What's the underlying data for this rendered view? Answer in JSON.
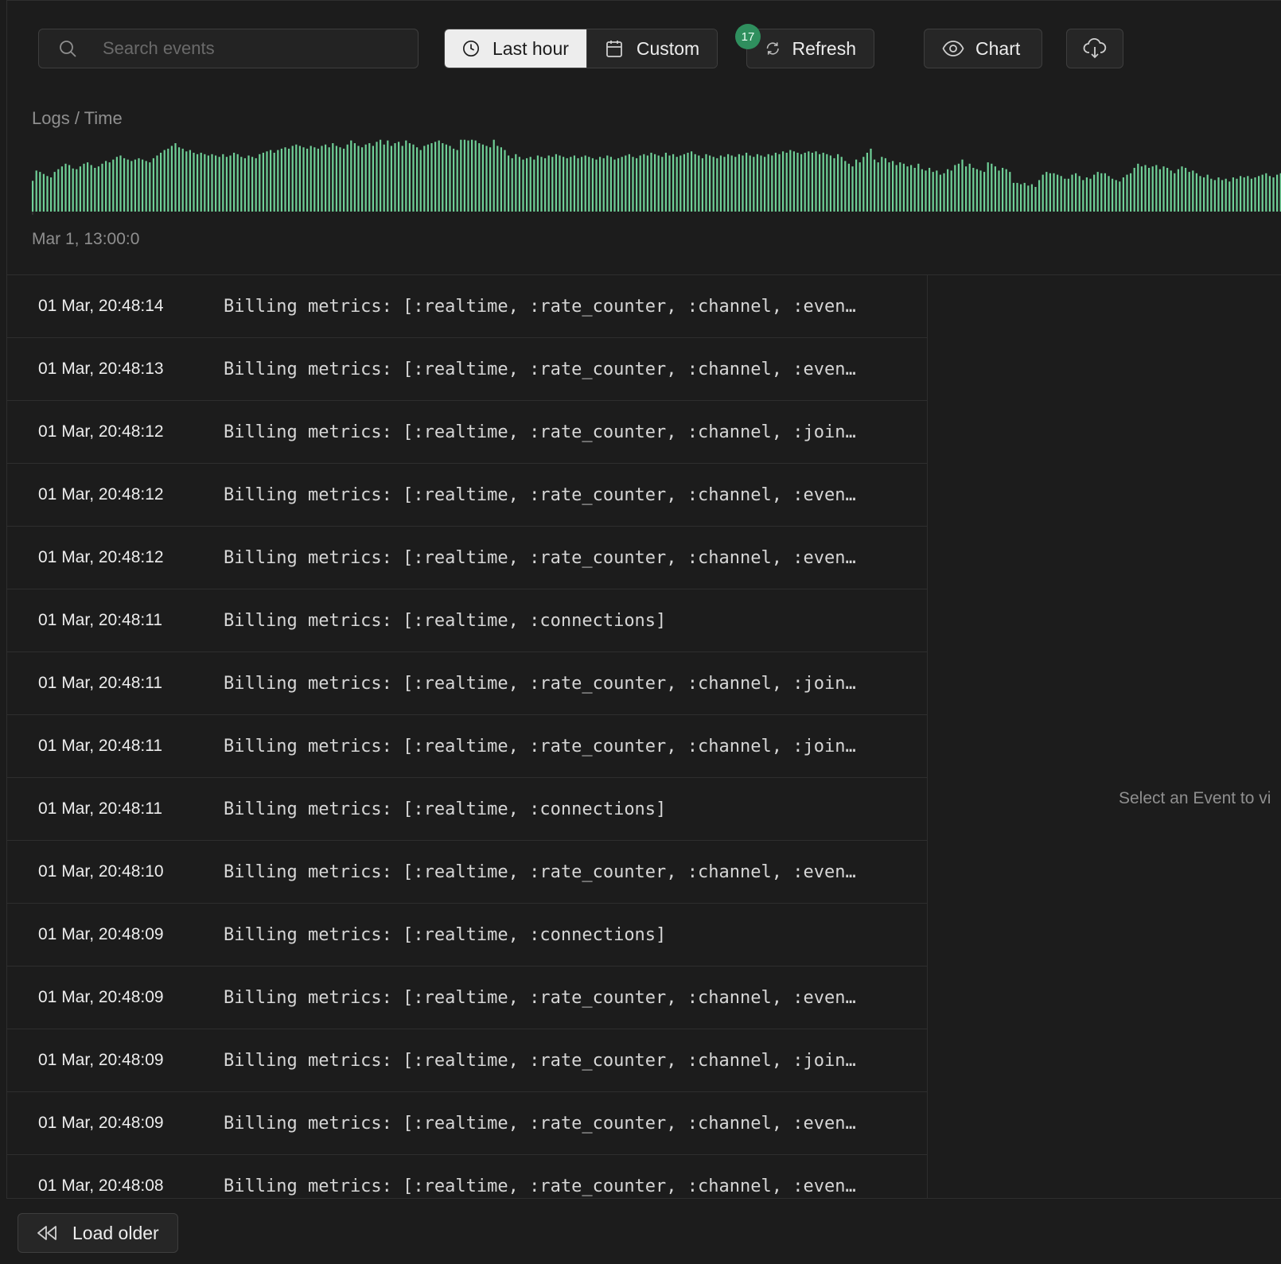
{
  "toolbar": {
    "search_placeholder": "Search events",
    "range_last_hour": "Last hour",
    "range_custom": "Custom",
    "refresh_label": "Refresh",
    "refresh_badge": "17",
    "chart_label": "Chart"
  },
  "chart": {
    "title": "Logs / Time",
    "start_label": "Mar 1, 13:00:0",
    "bar_color": "#6fcf97"
  },
  "chart_data": {
    "type": "bar",
    "title": "Logs / Time",
    "x_start": "Mar 1, 13:00:0",
    "values": [
      45,
      60,
      58,
      55,
      52,
      50,
      58,
      62,
      66,
      70,
      68,
      63,
      62,
      66,
      70,
      72,
      68,
      64,
      66,
      70,
      74,
      72,
      76,
      80,
      82,
      78,
      76,
      74,
      76,
      78,
      76,
      74,
      72,
      78,
      82,
      86,
      90,
      92,
      96,
      100,
      94,
      92,
      88,
      90,
      86,
      84,
      86,
      84,
      82,
      84,
      82,
      80,
      84,
      80,
      82,
      86,
      84,
      80,
      78,
      82,
      80,
      78,
      84,
      86,
      88,
      90,
      86,
      90,
      92,
      94,
      92,
      96,
      98,
      96,
      94,
      92,
      96,
      94,
      92,
      96,
      98,
      94,
      100,
      96,
      94,
      92,
      98,
      104,
      100,
      96,
      94,
      98,
      100,
      96,
      102,
      108,
      98,
      104,
      96,
      100,
      102,
      96,
      104,
      100,
      98,
      94,
      90,
      96,
      98,
      100,
      102,
      104,
      100,
      98,
      96,
      92,
      90,
      112,
      108,
      104,
      112,
      104,
      100,
      98,
      96,
      94,
      108,
      96,
      94,
      90,
      82,
      78,
      84,
      80,
      76,
      78,
      80,
      76,
      82,
      80,
      78,
      82,
      80,
      84,
      82,
      80,
      78,
      80,
      82,
      78,
      80,
      82,
      80,
      78,
      76,
      80,
      78,
      82,
      80,
      76,
      78,
      80,
      82,
      84,
      80,
      78,
      82,
      84,
      82,
      86,
      84,
      82,
      80,
      86,
      82,
      84,
      80,
      82,
      84,
      86,
      88,
      84,
      82,
      78,
      84,
      82,
      80,
      78,
      82,
      80,
      84,
      82,
      80,
      84,
      82,
      86,
      82,
      80,
      84,
      82,
      80,
      84,
      82,
      86,
      84,
      88,
      86,
      90,
      88,
      86,
      84,
      86,
      88,
      86,
      88,
      84,
      86,
      84,
      82,
      78,
      84,
      80,
      74,
      70,
      66,
      76,
      72,
      80,
      86,
      92,
      76,
      72,
      80,
      78,
      72,
      74,
      68,
      72,
      70,
      66,
      68,
      64,
      70,
      62,
      60,
      64,
      58,
      60,
      54,
      56,
      62,
      60,
      68,
      70,
      76,
      66,
      70,
      64,
      62,
      60,
      58,
      72,
      70,
      66,
      60,
      64,
      62,
      58,
      42,
      42,
      40,
      42,
      38,
      40,
      36,
      46,
      54,
      58,
      56,
      56,
      54,
      52,
      48,
      48,
      54,
      56,
      52,
      46,
      50,
      48,
      54,
      58,
      56,
      56,
      52,
      48,
      46,
      44,
      50,
      54,
      56,
      64,
      70,
      66,
      68,
      64,
      66,
      68,
      62,
      66,
      64,
      60,
      56,
      62,
      66,
      64,
      58,
      60,
      56,
      52,
      50,
      54,
      48,
      46,
      50,
      46,
      48,
      44,
      50,
      48,
      52,
      50,
      52,
      48,
      50,
      52,
      54,
      56,
      52,
      50,
      54,
      56,
      58,
      54,
      52,
      56,
      60
    ],
    "ylim": [
      0,
      100
    ]
  },
  "logs": [
    {
      "ts": "01 Mar, 20:48:14",
      "msg": "Billing metrics: [:realtime, :rate_counter, :channel, :even…"
    },
    {
      "ts": "01 Mar, 20:48:13",
      "msg": "Billing metrics: [:realtime, :rate_counter, :channel, :even…"
    },
    {
      "ts": "01 Mar, 20:48:12",
      "msg": "Billing metrics: [:realtime, :rate_counter, :channel, :join…"
    },
    {
      "ts": "01 Mar, 20:48:12",
      "msg": "Billing metrics: [:realtime, :rate_counter, :channel, :even…"
    },
    {
      "ts": "01 Mar, 20:48:12",
      "msg": "Billing metrics: [:realtime, :rate_counter, :channel, :even…"
    },
    {
      "ts": "01 Mar, 20:48:11",
      "msg": "Billing metrics: [:realtime, :connections]"
    },
    {
      "ts": "01 Mar, 20:48:11",
      "msg": "Billing metrics: [:realtime, :rate_counter, :channel, :join…"
    },
    {
      "ts": "01 Mar, 20:48:11",
      "msg": "Billing metrics: [:realtime, :rate_counter, :channel, :join…"
    },
    {
      "ts": "01 Mar, 20:48:11",
      "msg": "Billing metrics: [:realtime, :connections]"
    },
    {
      "ts": "01 Mar, 20:48:10",
      "msg": "Billing metrics: [:realtime, :rate_counter, :channel, :even…"
    },
    {
      "ts": "01 Mar, 20:48:09",
      "msg": "Billing metrics: [:realtime, :connections]"
    },
    {
      "ts": "01 Mar, 20:48:09",
      "msg": "Billing metrics: [:realtime, :rate_counter, :channel, :even…"
    },
    {
      "ts": "01 Mar, 20:48:09",
      "msg": "Billing metrics: [:realtime, :rate_counter, :channel, :join…"
    },
    {
      "ts": "01 Mar, 20:48:09",
      "msg": "Billing metrics: [:realtime, :rate_counter, :channel, :even…"
    },
    {
      "ts": "01 Mar, 20:48:08",
      "msg": "Billing metrics: [:realtime, :rate_counter, :channel, :even…"
    }
  ],
  "detail_panel": {
    "empty_text": "Select an Event to vi"
  },
  "footer": {
    "load_older_label": "Load older"
  }
}
